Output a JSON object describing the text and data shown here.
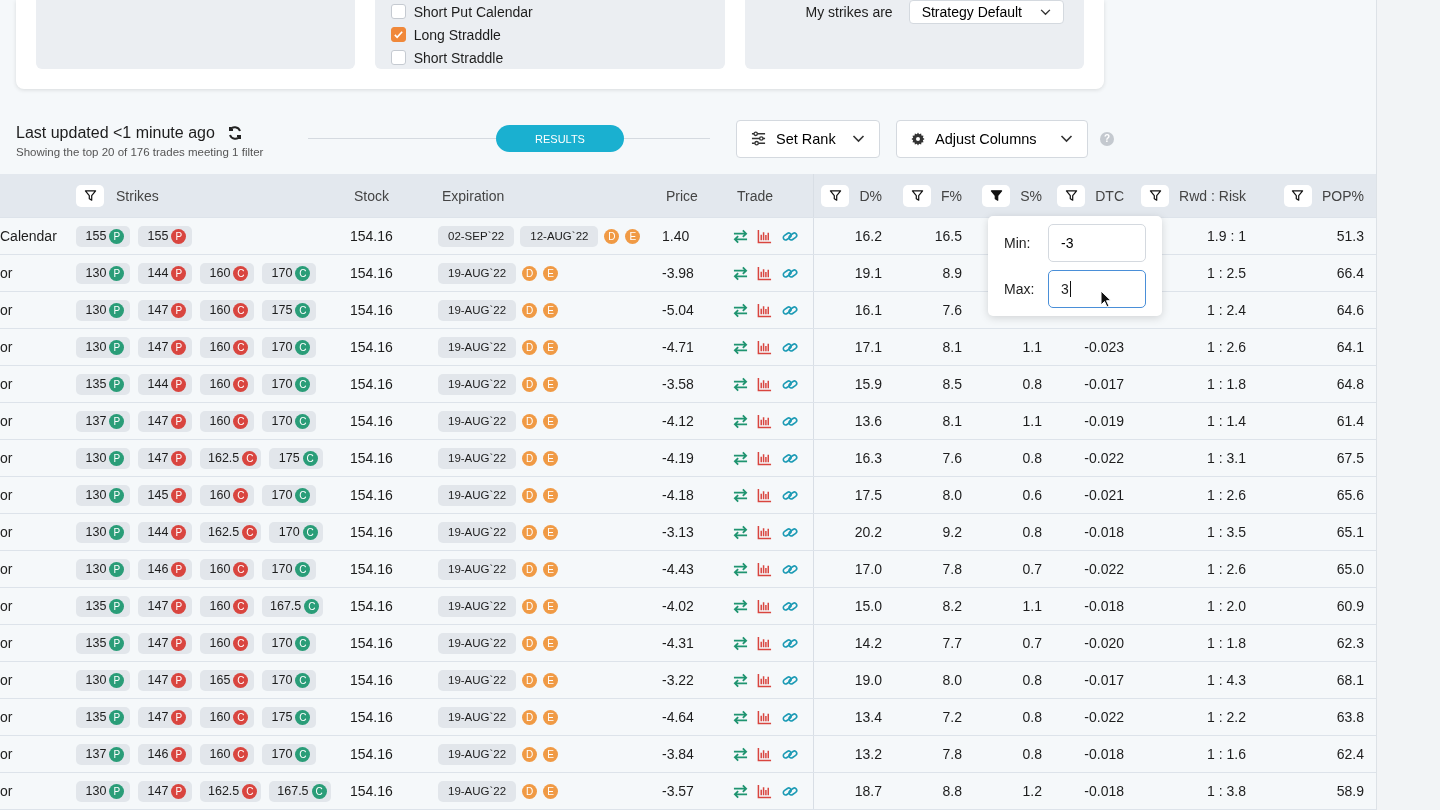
{
  "filters_card": {
    "strategies": [
      {
        "label": "Short Put Calendar",
        "checked": false
      },
      {
        "label": "Long Straddle",
        "checked": true
      },
      {
        "label": "Short Straddle",
        "checked": false
      }
    ],
    "strikes_label": "My strikes are",
    "strikes_select": "Strategy Default"
  },
  "toolbar": {
    "last_updated": "Last updated <1 minute ago",
    "summary": "Showing the top 20 of 176 trades meeting 1 filter",
    "results_label": "RESULTS",
    "set_rank": "Set Rank",
    "adjust_columns": "Adjust Columns",
    "help": "?"
  },
  "table": {
    "columns": [
      {
        "label": "Strikes",
        "filtered": false
      },
      {
        "label": "Stock"
      },
      {
        "label": "Expiration"
      },
      {
        "label": "Price"
      },
      {
        "label": "Trade"
      },
      {
        "label": "D%",
        "filtered": false
      },
      {
        "label": "F%",
        "filtered": false
      },
      {
        "label": "S%",
        "filtered": true
      },
      {
        "label": "DTC",
        "filtered": false
      },
      {
        "label": "Rwd : Risk",
        "filtered": false
      },
      {
        "label": "POP%",
        "filtered": false
      }
    ],
    "rows": [
      {
        "name": "Calendar",
        "strikes": [
          {
            "v": "155",
            "t": "P",
            "color": "#2a9d78"
          },
          {
            "v": "155",
            "t": "P",
            "color": "#d9453f"
          }
        ],
        "stock": "154.16",
        "expirations": [
          "02-SEP`22",
          "12-AUG`22"
        ],
        "badges": [
          "D",
          "E"
        ],
        "price": "1.40",
        "d": "16.2",
        "f": "16.5",
        "rwd_risk": "1.9 : 1",
        "pop": "51.3"
      },
      {
        "name": "or",
        "strikes": [
          {
            "v": "130",
            "t": "P",
            "color": "#2a9d78"
          },
          {
            "v": "144",
            "t": "P",
            "color": "#d9453f"
          },
          {
            "v": "160",
            "t": "C",
            "color": "#d9453f"
          },
          {
            "v": "170",
            "t": "C",
            "color": "#2a9d78"
          }
        ],
        "stock": "154.16",
        "expirations": [
          "19-AUG`22"
        ],
        "badges": [
          "D",
          "E"
        ],
        "price": "-3.98",
        "d": "19.1",
        "f": "8.9",
        "rwd_risk": "1 : 2.5",
        "pop": "66.4"
      },
      {
        "name": "or",
        "strikes": [
          {
            "v": "130",
            "t": "P",
            "color": "#2a9d78"
          },
          {
            "v": "147",
            "t": "P",
            "color": "#d9453f"
          },
          {
            "v": "160",
            "t": "C",
            "color": "#d9453f"
          },
          {
            "v": "175",
            "t": "C",
            "color": "#2a9d78"
          }
        ],
        "stock": "154.16",
        "expirations": [
          "19-AUG`22"
        ],
        "badges": [
          "D",
          "E"
        ],
        "price": "-5.04",
        "d": "16.1",
        "f": "7.6",
        "rwd_risk": "1 : 2.4",
        "pop": "64.6"
      },
      {
        "name": "or",
        "strikes": [
          {
            "v": "130",
            "t": "P",
            "color": "#2a9d78"
          },
          {
            "v": "147",
            "t": "P",
            "color": "#d9453f"
          },
          {
            "v": "160",
            "t": "C",
            "color": "#d9453f"
          },
          {
            "v": "170",
            "t": "C",
            "color": "#2a9d78"
          }
        ],
        "stock": "154.16",
        "expirations": [
          "19-AUG`22"
        ],
        "badges": [
          "D",
          "E"
        ],
        "price": "-4.71",
        "d": "17.1",
        "f": "8.1",
        "s": "1.1",
        "dtc": "-0.023",
        "rwd_risk": "1 : 2.6",
        "pop": "64.1"
      },
      {
        "name": "or",
        "strikes": [
          {
            "v": "135",
            "t": "P",
            "color": "#2a9d78"
          },
          {
            "v": "144",
            "t": "P",
            "color": "#d9453f"
          },
          {
            "v": "160",
            "t": "C",
            "color": "#d9453f"
          },
          {
            "v": "170",
            "t": "C",
            "color": "#2a9d78"
          }
        ],
        "stock": "154.16",
        "expirations": [
          "19-AUG`22"
        ],
        "badges": [
          "D",
          "E"
        ],
        "price": "-3.58",
        "d": "15.9",
        "f": "8.5",
        "s": "0.8",
        "dtc": "-0.017",
        "rwd_risk": "1 : 1.8",
        "pop": "64.8"
      },
      {
        "name": "or",
        "strikes": [
          {
            "v": "137",
            "t": "P",
            "color": "#2a9d78"
          },
          {
            "v": "147",
            "t": "P",
            "color": "#d9453f"
          },
          {
            "v": "160",
            "t": "C",
            "color": "#d9453f"
          },
          {
            "v": "170",
            "t": "C",
            "color": "#2a9d78"
          }
        ],
        "stock": "154.16",
        "expirations": [
          "19-AUG`22"
        ],
        "badges": [
          "D",
          "E"
        ],
        "price": "-4.12",
        "d": "13.6",
        "f": "8.1",
        "s": "1.1",
        "dtc": "-0.019",
        "rwd_risk": "1 : 1.4",
        "pop": "61.4"
      },
      {
        "name": "or",
        "strikes": [
          {
            "v": "130",
            "t": "P",
            "color": "#2a9d78"
          },
          {
            "v": "147",
            "t": "P",
            "color": "#d9453f"
          },
          {
            "v": "162.5",
            "t": "C",
            "color": "#d9453f"
          },
          {
            "v": "175",
            "t": "C",
            "color": "#2a9d78"
          }
        ],
        "stock": "154.16",
        "expirations": [
          "19-AUG`22"
        ],
        "badges": [
          "D",
          "E"
        ],
        "price": "-4.19",
        "d": "16.3",
        "f": "7.6",
        "s": "0.8",
        "dtc": "-0.022",
        "rwd_risk": "1 : 3.1",
        "pop": "67.5"
      },
      {
        "name": "or",
        "strikes": [
          {
            "v": "130",
            "t": "P",
            "color": "#2a9d78"
          },
          {
            "v": "145",
            "t": "P",
            "color": "#d9453f"
          },
          {
            "v": "160",
            "t": "C",
            "color": "#d9453f"
          },
          {
            "v": "170",
            "t": "C",
            "color": "#2a9d78"
          }
        ],
        "stock": "154.16",
        "expirations": [
          "19-AUG`22"
        ],
        "badges": [
          "D",
          "E"
        ],
        "price": "-4.18",
        "d": "17.5",
        "f": "8.0",
        "s": "0.6",
        "dtc": "-0.021",
        "rwd_risk": "1 : 2.6",
        "pop": "65.6"
      },
      {
        "name": "or",
        "strikes": [
          {
            "v": "130",
            "t": "P",
            "color": "#2a9d78"
          },
          {
            "v": "144",
            "t": "P",
            "color": "#d9453f"
          },
          {
            "v": "162.5",
            "t": "C",
            "color": "#d9453f"
          },
          {
            "v": "170",
            "t": "C",
            "color": "#2a9d78"
          }
        ],
        "stock": "154.16",
        "expirations": [
          "19-AUG`22"
        ],
        "badges": [
          "D",
          "E"
        ],
        "price": "-3.13",
        "d": "20.2",
        "f": "9.2",
        "s": "0.8",
        "dtc": "-0.018",
        "rwd_risk": "1 : 3.5",
        "pop": "65.1"
      },
      {
        "name": "or",
        "strikes": [
          {
            "v": "130",
            "t": "P",
            "color": "#2a9d78"
          },
          {
            "v": "146",
            "t": "P",
            "color": "#d9453f"
          },
          {
            "v": "160",
            "t": "C",
            "color": "#d9453f"
          },
          {
            "v": "170",
            "t": "C",
            "color": "#2a9d78"
          }
        ],
        "stock": "154.16",
        "expirations": [
          "19-AUG`22"
        ],
        "badges": [
          "D",
          "E"
        ],
        "price": "-4.43",
        "d": "17.0",
        "f": "7.8",
        "s": "0.7",
        "dtc": "-0.022",
        "rwd_risk": "1 : 2.6",
        "pop": "65.0"
      },
      {
        "name": "or",
        "strikes": [
          {
            "v": "135",
            "t": "P",
            "color": "#2a9d78"
          },
          {
            "v": "147",
            "t": "P",
            "color": "#d9453f"
          },
          {
            "v": "160",
            "t": "C",
            "color": "#d9453f"
          },
          {
            "v": "167.5",
            "t": "C",
            "color": "#2a9d78"
          }
        ],
        "stock": "154.16",
        "expirations": [
          "19-AUG`22"
        ],
        "badges": [
          "D",
          "E"
        ],
        "price": "-4.02",
        "d": "15.0",
        "f": "8.2",
        "s": "1.1",
        "dtc": "-0.018",
        "rwd_risk": "1 : 2.0",
        "pop": "60.9"
      },
      {
        "name": "or",
        "strikes": [
          {
            "v": "135",
            "t": "P",
            "color": "#2a9d78"
          },
          {
            "v": "147",
            "t": "P",
            "color": "#d9453f"
          },
          {
            "v": "160",
            "t": "C",
            "color": "#d9453f"
          },
          {
            "v": "170",
            "t": "C",
            "color": "#2a9d78"
          }
        ],
        "stock": "154.16",
        "expirations": [
          "19-AUG`22"
        ],
        "badges": [
          "D",
          "E"
        ],
        "price": "-4.31",
        "d": "14.2",
        "f": "7.7",
        "s": "0.7",
        "dtc": "-0.020",
        "rwd_risk": "1 : 1.8",
        "pop": "62.3"
      },
      {
        "name": "or",
        "strikes": [
          {
            "v": "130",
            "t": "P",
            "color": "#2a9d78"
          },
          {
            "v": "147",
            "t": "P",
            "color": "#d9453f"
          },
          {
            "v": "165",
            "t": "C",
            "color": "#d9453f"
          },
          {
            "v": "170",
            "t": "C",
            "color": "#2a9d78"
          }
        ],
        "stock": "154.16",
        "expirations": [
          "19-AUG`22"
        ],
        "badges": [
          "D",
          "E"
        ],
        "price": "-3.22",
        "d": "19.0",
        "f": "8.0",
        "s": "0.8",
        "dtc": "-0.017",
        "rwd_risk": "1 : 4.3",
        "pop": "68.1"
      },
      {
        "name": "or",
        "strikes": [
          {
            "v": "135",
            "t": "P",
            "color": "#2a9d78"
          },
          {
            "v": "147",
            "t": "P",
            "color": "#d9453f"
          },
          {
            "v": "160",
            "t": "C",
            "color": "#d9453f"
          },
          {
            "v": "175",
            "t": "C",
            "color": "#2a9d78"
          }
        ],
        "stock": "154.16",
        "expirations": [
          "19-AUG`22"
        ],
        "badges": [
          "D",
          "E"
        ],
        "price": "-4.64",
        "d": "13.4",
        "f": "7.2",
        "s": "0.8",
        "dtc": "-0.022",
        "rwd_risk": "1 : 2.2",
        "pop": "63.8"
      },
      {
        "name": "or",
        "strikes": [
          {
            "v": "137",
            "t": "P",
            "color": "#2a9d78"
          },
          {
            "v": "146",
            "t": "P",
            "color": "#d9453f"
          },
          {
            "v": "160",
            "t": "C",
            "color": "#d9453f"
          },
          {
            "v": "170",
            "t": "C",
            "color": "#2a9d78"
          }
        ],
        "stock": "154.16",
        "expirations": [
          "19-AUG`22"
        ],
        "badges": [
          "D",
          "E"
        ],
        "price": "-3.84",
        "d": "13.2",
        "f": "7.8",
        "s": "0.8",
        "dtc": "-0.018",
        "rwd_risk": "1 : 1.6",
        "pop": "62.4"
      },
      {
        "name": "or",
        "strikes": [
          {
            "v": "130",
            "t": "P",
            "color": "#2a9d78"
          },
          {
            "v": "147",
            "t": "P",
            "color": "#d9453f"
          },
          {
            "v": "162.5",
            "t": "C",
            "color": "#d9453f"
          },
          {
            "v": "167.5",
            "t": "C",
            "color": "#2a9d78"
          }
        ],
        "stock": "154.16",
        "expirations": [
          "19-AUG`22"
        ],
        "badges": [
          "D",
          "E"
        ],
        "price": "-3.57",
        "d": "18.7",
        "f": "8.8",
        "s": "1.2",
        "dtc": "-0.018",
        "rwd_risk": "1 : 3.8",
        "pop": "58.9"
      }
    ]
  },
  "filter_popup": {
    "min_label": "Min:",
    "min_value": "-3",
    "max_label": "Max:",
    "max_value": "3",
    "max_focused": true
  }
}
